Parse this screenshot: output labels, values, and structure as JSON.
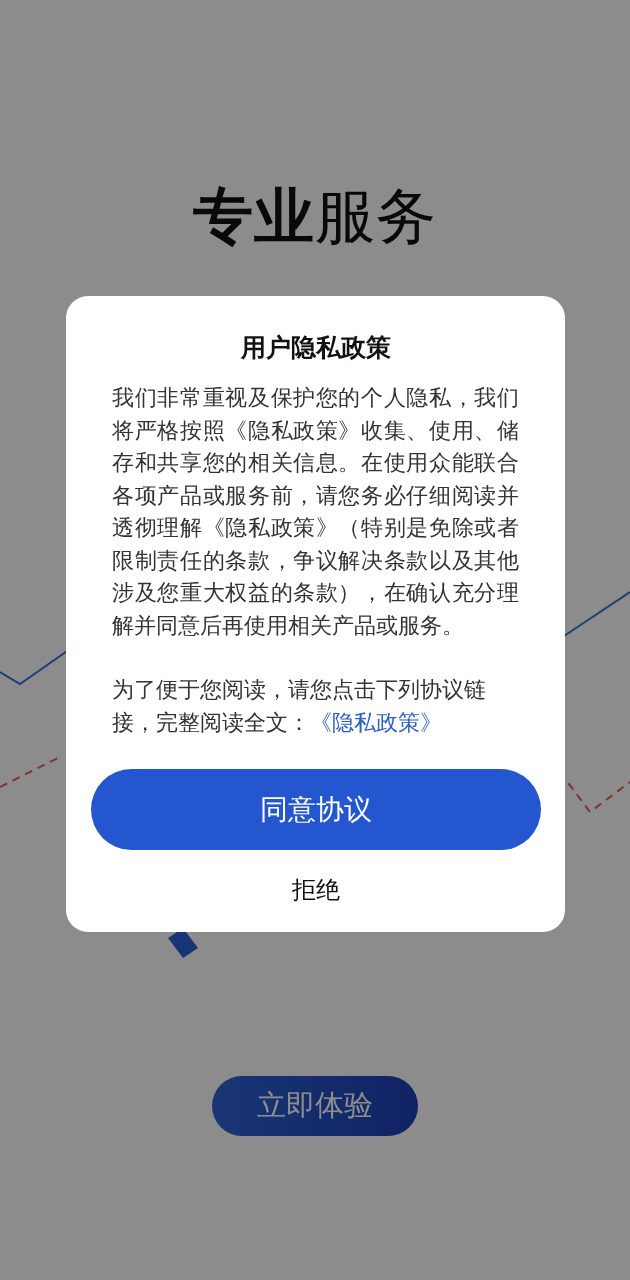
{
  "background": {
    "title": "**专业**服务",
    "button": "立即体验"
  },
  "dialog": {
    "title": "用户隐私政策",
    "paragraphs": [
      "我们非常重视及保护您的个人隐私，我们将严格按照《隐私政策》收集、使用、储存和共享您的相关信息。在使用众能联合各项产品或服务前，请您务必仔细阅读并透彻理解《隐私政策》（特别是免除或者限制责任的条款，争议解决条款以及其他涉及您重大权益的条款），在确认充分理解并同意后再使用相关产品或服务。"
    ],
    "notice": {
      "text": "为了便于您阅读，请您点击下列协议链接，完整阅读全文：",
      "link": "《隐私政策》"
    },
    "agree_button": "同意协议",
    "reject_button": "拒绝"
  }
}
